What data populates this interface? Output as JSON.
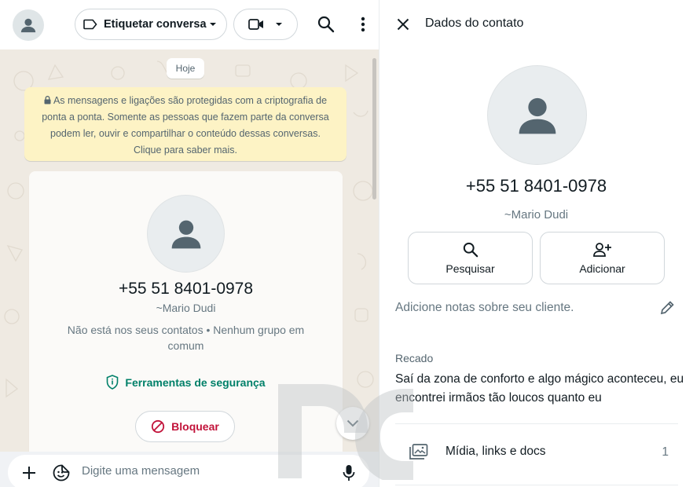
{
  "header": {
    "label_button": "Etiquetar conversa"
  },
  "chat": {
    "date_chip": "Hoje",
    "e2e_notice": "As mensagens e ligações são protegidas com a criptografia de ponta a ponta. Somente as pessoas que fazem parte da conversa podem ler, ouvir e compartilhar o conteúdo dessas conversas. Clique para saber mais.",
    "card": {
      "phone": "+55 51 8401-0978",
      "name": "~Mario Dudi",
      "info": "Não está nos seus contatos • Nenhum grupo em comum",
      "security_link": "Ferramentas de segurança",
      "block_button": "Bloquear"
    },
    "composer": {
      "placeholder": "Digite uma mensagem"
    }
  },
  "details": {
    "title": "Dados do contato",
    "phone": "+55 51 8401-0978",
    "name": "~Mario Dudi",
    "actions": [
      {
        "label": "Pesquisar",
        "icon": "search-icon"
      },
      {
        "label": "Adicionar",
        "icon": "add-person-icon"
      }
    ],
    "notes_placeholder": "Adicione notas sobre seu cliente.",
    "about_label": "Recado",
    "about_text": "Saí da zona de conforto e algo mágico aconteceu, eu encontrei irmãos tão loucos quanto eu",
    "media": {
      "label": "Mídia, links e docs",
      "count": "1"
    }
  },
  "colors": {
    "accent_green": "#008069",
    "danger_red": "#c2133a",
    "notice_yellow": "#fdf3c5",
    "chat_wallpaper": "#efeae2"
  }
}
